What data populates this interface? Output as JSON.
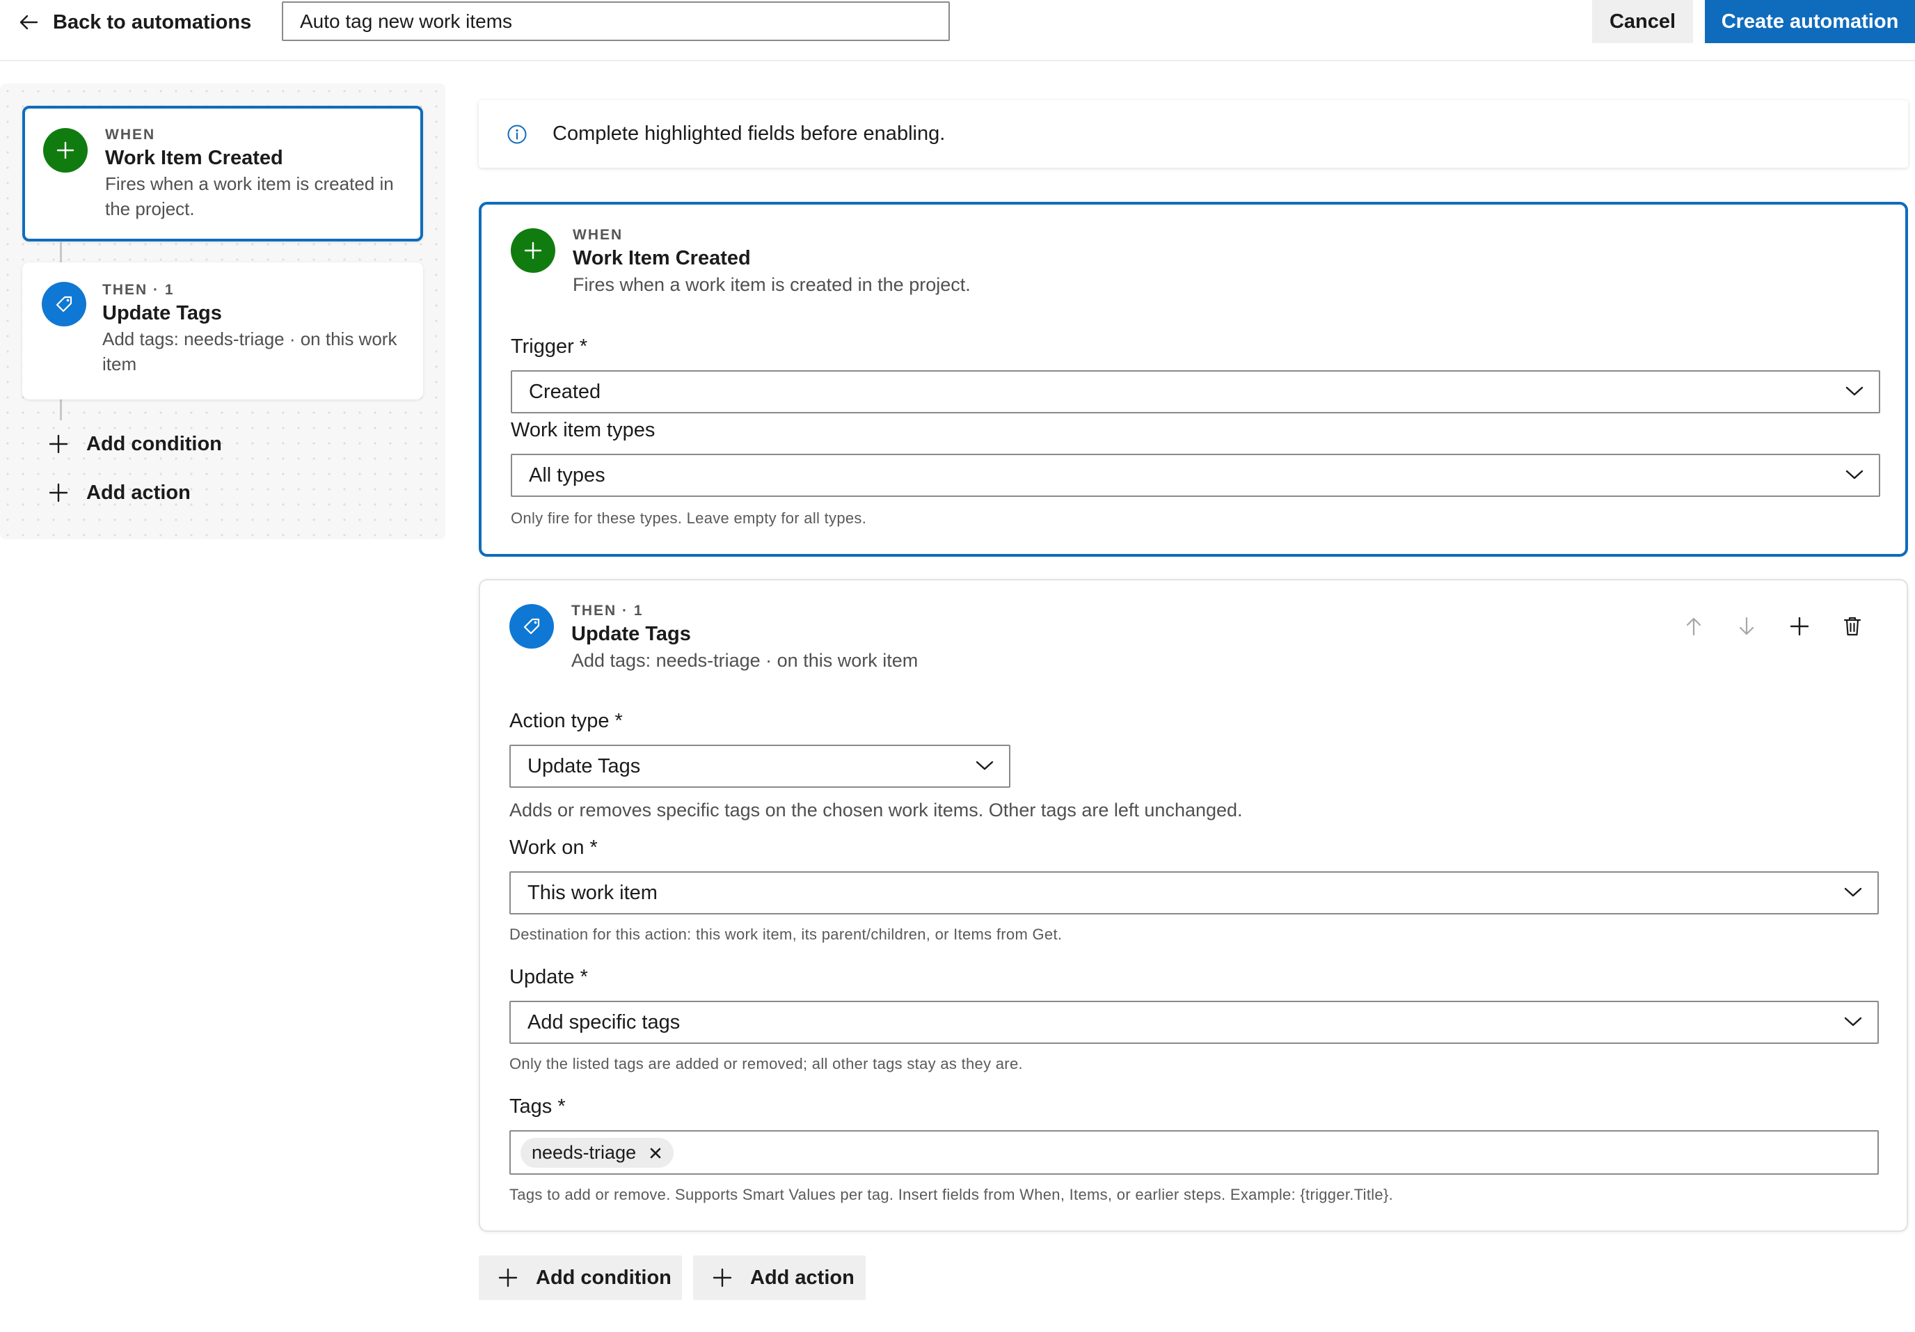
{
  "header": {
    "back_label": "Back to automations",
    "name_value": "Auto tag new work items",
    "cancel_label": "Cancel",
    "create_label": "Create automation"
  },
  "sidebar": {
    "when_card": {
      "eyebrow": "WHEN",
      "title": "Work Item Created",
      "description": "Fires when a work item is created in the project.",
      "icon": "plus-icon"
    },
    "then_card": {
      "eyebrow": "THEN · 1",
      "title": "Update Tags",
      "description": "Add tags: needs-triage · on this work item",
      "icon": "tag-icon"
    },
    "add_condition_label": "Add condition",
    "add_action_label": "Add action"
  },
  "banner": {
    "text": "Complete highlighted fields before enabling.",
    "icon": "info-icon"
  },
  "when_panel": {
    "eyebrow": "WHEN",
    "title": "Work Item Created",
    "description": "Fires when a work item is created in the project.",
    "trigger_label": "Trigger *",
    "trigger_value": "Created",
    "types_label": "Work item types",
    "types_value": "All types",
    "types_hint": "Only fire for these types. Leave empty for all types."
  },
  "then_panel": {
    "eyebrow": "THEN · 1",
    "title": "Update Tags",
    "description": "Add tags: needs-triage · on this work item",
    "action_type_label": "Action type *",
    "action_type_value": "Update Tags",
    "action_type_desc": "Adds or removes specific tags on the chosen work items. Other tags are left unchanged.",
    "work_on_label": "Work on *",
    "work_on_value": "This work item",
    "work_on_hint": "Destination for this action: this work item, its parent/children, or Items from Get.",
    "update_label": "Update *",
    "update_value": "Add specific tags",
    "update_hint": "Only the listed tags are added or removed; all other tags stay as they are.",
    "tags_label": "Tags *",
    "tags": [
      "needs-triage"
    ],
    "tags_hint": "Tags to add or remove. Supports Smart Values per tag. Insert fields from When, Items, or earlier steps. Example: {trigger.Title}."
  },
  "footer": {
    "add_condition_label": "Add condition",
    "add_action_label": "Add action"
  },
  "colors": {
    "accent": "#0f6cbd",
    "success": "#107c10",
    "tag_blue": "#0f78d4"
  }
}
